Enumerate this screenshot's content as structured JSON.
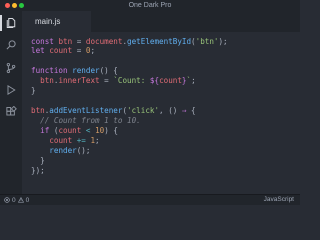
{
  "window": {
    "title": "One Dark Pro"
  },
  "activity_bar": {
    "icons": [
      "files-icon",
      "search-icon",
      "source-control-icon",
      "run-debug-icon",
      "extensions-icon"
    ]
  },
  "tabs": [
    {
      "label": "main.js",
      "active": true
    }
  ],
  "code": [
    [
      [
        "kw",
        "const"
      ],
      [
        "pl",
        " "
      ],
      [
        "def",
        "btn"
      ],
      [
        "pl",
        " = "
      ],
      [
        "def",
        "document"
      ],
      [
        "pl",
        "."
      ],
      [
        "fn",
        "getElementById"
      ],
      [
        "pl",
        "("
      ],
      [
        "str",
        "'btn'"
      ],
      [
        "pl",
        ");"
      ]
    ],
    [
      [
        "kw",
        "let"
      ],
      [
        "pl",
        " "
      ],
      [
        "def",
        "count"
      ],
      [
        "pl",
        " = "
      ],
      [
        "num",
        "0"
      ],
      [
        "pl",
        ";"
      ]
    ],
    [],
    [
      [
        "kw",
        "function"
      ],
      [
        "pl",
        " "
      ],
      [
        "fn",
        "render"
      ],
      [
        "pl",
        "() {"
      ]
    ],
    [
      [
        "pl",
        "  "
      ],
      [
        "def",
        "btn"
      ],
      [
        "pl",
        "."
      ],
      [
        "def",
        "innerText"
      ],
      [
        "pl",
        " = "
      ],
      [
        "str",
        "`Count: "
      ],
      [
        "kw",
        "${"
      ],
      [
        "def",
        "count"
      ],
      [
        "kw",
        "}"
      ],
      [
        "str",
        "`"
      ],
      [
        "pl",
        ";"
      ]
    ],
    [
      [
        "pl",
        "}"
      ]
    ],
    [],
    [
      [
        "def",
        "btn"
      ],
      [
        "pl",
        "."
      ],
      [
        "fn",
        "addEventListener"
      ],
      [
        "pl",
        "("
      ],
      [
        "str",
        "'click'"
      ],
      [
        "pl",
        ", () "
      ],
      [
        "kw",
        "⇒"
      ],
      [
        "pl",
        " {"
      ]
    ],
    [
      [
        "pl",
        "  "
      ],
      [
        "cm",
        "// Count from 1 to 10."
      ]
    ],
    [
      [
        "pl",
        "  "
      ],
      [
        "kw",
        "if"
      ],
      [
        "pl",
        " ("
      ],
      [
        "def",
        "count"
      ],
      [
        "pl",
        " "
      ],
      [
        "op",
        "<"
      ],
      [
        "pl",
        " "
      ],
      [
        "num",
        "10"
      ],
      [
        "pl",
        ") {"
      ]
    ],
    [
      [
        "pl",
        "    "
      ],
      [
        "def",
        "count"
      ],
      [
        "pl",
        " "
      ],
      [
        "op",
        "+="
      ],
      [
        "pl",
        " "
      ],
      [
        "num",
        "1"
      ],
      [
        "pl",
        ";"
      ]
    ],
    [
      [
        "pl",
        "    "
      ],
      [
        "fn",
        "render"
      ],
      [
        "pl",
        "();"
      ]
    ],
    [
      [
        "pl",
        "  }"
      ]
    ],
    [
      [
        "pl",
        "});"
      ]
    ]
  ],
  "status_bar": {
    "errors": "0",
    "warnings": "0",
    "language": "JavaScript"
  },
  "colors": {
    "background": "#282c34",
    "chrome": "#21252b",
    "keyword": "#c678dd",
    "variable": "#e06c75",
    "function": "#61afef",
    "string": "#98c379",
    "number": "#d19a66",
    "comment": "#7f848e"
  }
}
